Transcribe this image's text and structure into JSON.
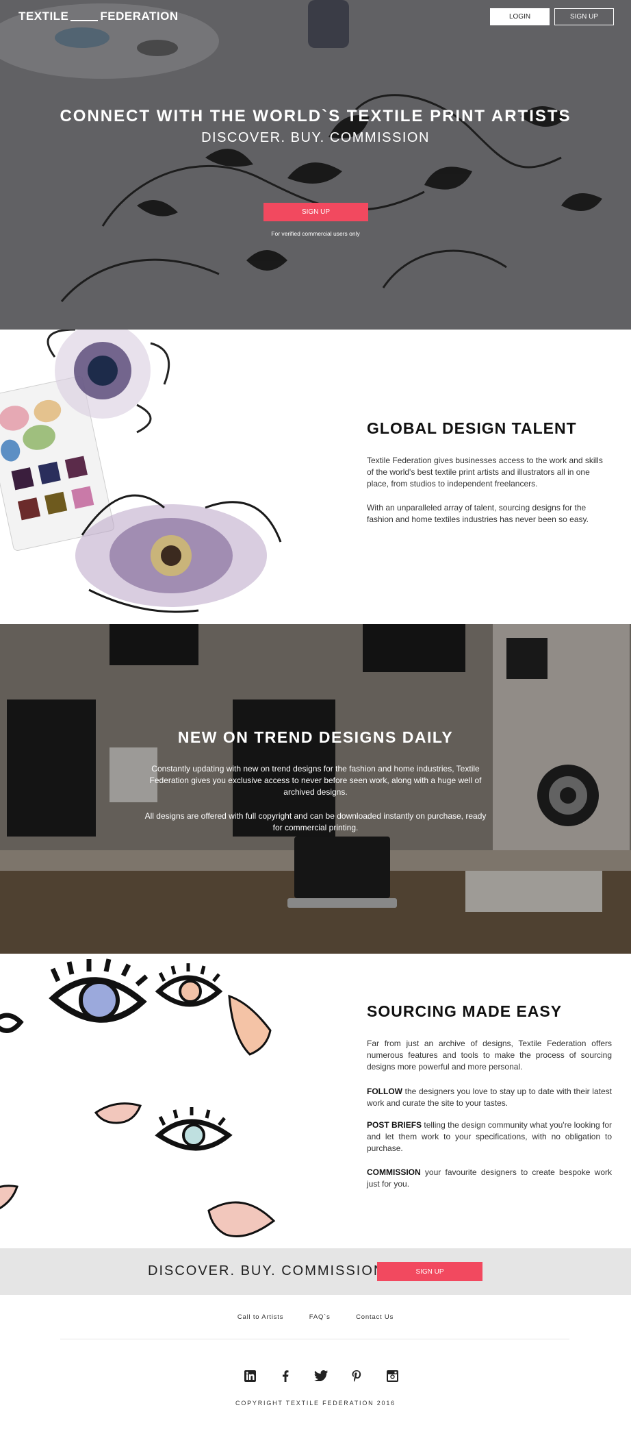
{
  "header": {
    "logo_left": "TEXTILE",
    "logo_right": "FEDERATION",
    "login_label": "LOGIN",
    "signup_label": "SIGN UP"
  },
  "hero": {
    "title": "CONNECT WITH THE WORLD`S TEXTILE PRINT ARTISTS",
    "subtitle": "DISCOVER. BUY. COMMISSION",
    "cta_label": "SIGN UP",
    "note": "For verified commercial users only"
  },
  "global_talent": {
    "title": "GLOBAL DESIGN TALENT",
    "p1": "Textile Federation gives businesses access to the work and skills of the world's best textile print artists and illustrators all in one place, from studios to independent freelancers.",
    "p2": "With an unparalleled array of talent, sourcing designs for the fashion and home textiles industries has never been so easy."
  },
  "trend": {
    "title": "NEW ON TREND DESIGNS DAILY",
    "p1": "Constantly updating with new on trend designs for the fashion and home industries, Textile Federation gives you exclusive access to never before seen work, along with a huge well of archived designs.",
    "p2": "All designs are offered with full copyright and can be downloaded instantly on purchase, ready for commercial printing."
  },
  "sourcing": {
    "title": "SOURCING MADE EASY",
    "intro": "Far from just an archive of designs, Textile Federation offers numerous features and tools to make the process of sourcing designs more powerful and more personal.",
    "follow_label": "FOLLOW",
    "follow_text": " the designers you love to stay up to date with their latest work and curate the site to your tastes.",
    "briefs_label": "POST BRIEFS",
    "briefs_text": " telling the design community what you're looking for and let them work to your specifications, with no obligation to purchase.",
    "commission_label": "COMMISSION",
    "commission_text": " your favourite designers to create bespoke work just for you."
  },
  "band": {
    "text": "DISCOVER. BUY. COMMISSION",
    "cta_label": "SIGN UP"
  },
  "footer": {
    "links": [
      "Call to Artists",
      "FAQ`s",
      "Contact Us"
    ],
    "social_icons": [
      "linkedin-icon",
      "facebook-icon",
      "twitter-icon",
      "pinterest-icon",
      "instagram-icon"
    ],
    "copyright": "COPYRIGHT TEXTILE FEDERATION 2016"
  },
  "colors": {
    "accent": "#f2495f",
    "band_bg": "#e5e5e5"
  }
}
